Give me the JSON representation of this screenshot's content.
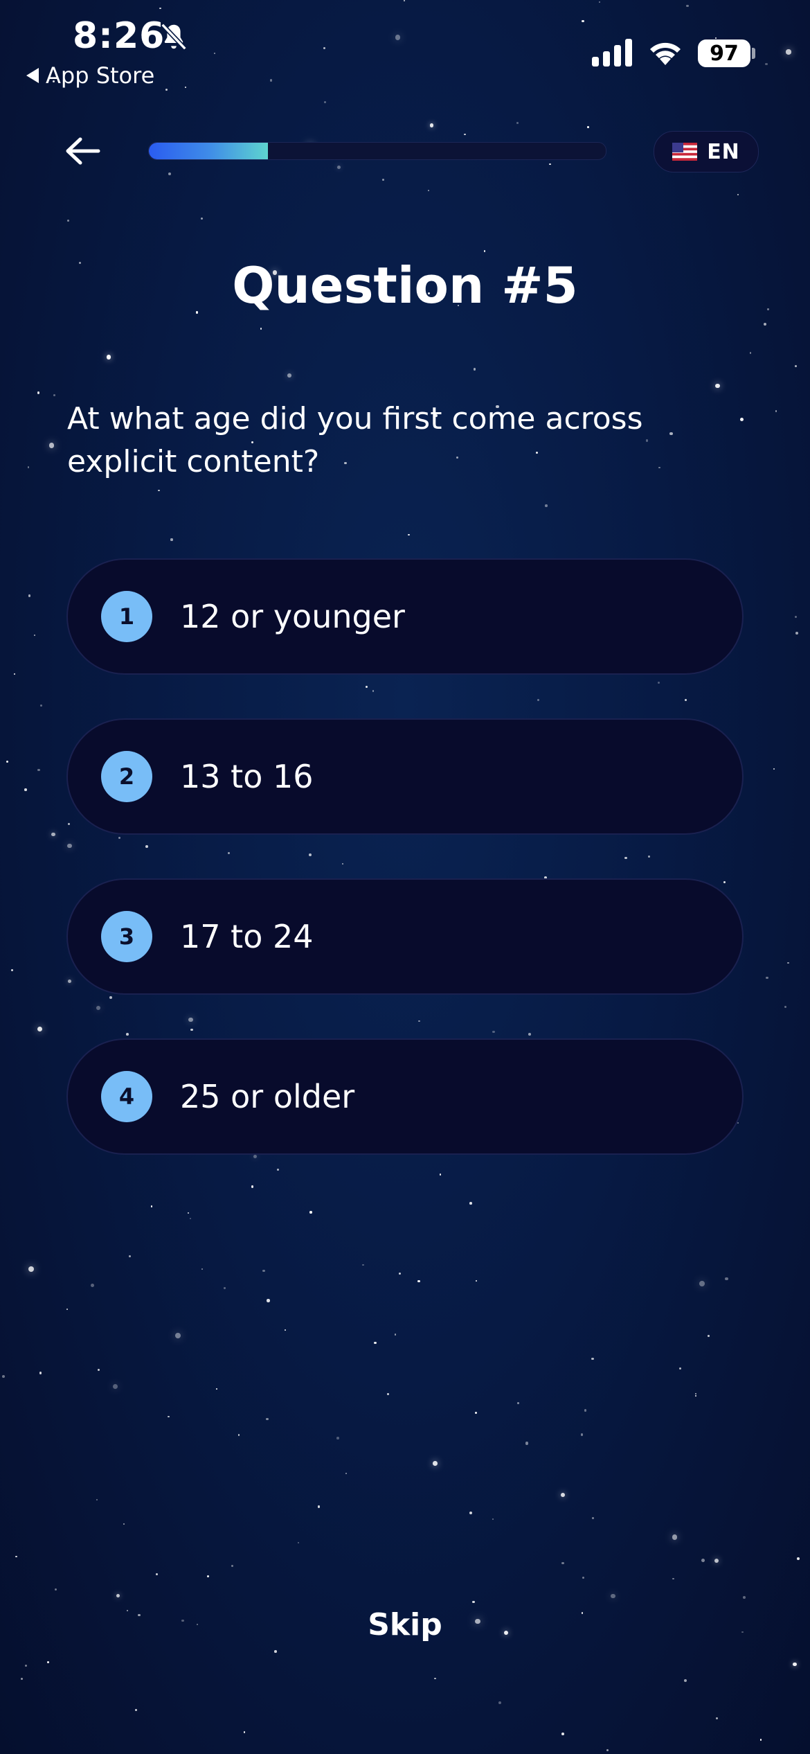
{
  "status_bar": {
    "time": "8:26",
    "back_app": "App Store",
    "battery": "97"
  },
  "nav": {
    "progress": 0.26,
    "language": "EN"
  },
  "title": "Question #5",
  "question": "At what age did you first come across explicit content?",
  "options": [
    {
      "number": "1",
      "label": "12 or younger"
    },
    {
      "number": "2",
      "label": "13 to 16"
    },
    {
      "number": "3",
      "label": "17 to 24"
    },
    {
      "number": "4",
      "label": "25 or older"
    }
  ],
  "skip_label": "Skip",
  "icons": {
    "mute": "bell-slash-icon",
    "signal": "cellular-signal-icon",
    "wifi": "wifi-icon",
    "back": "arrow-left-icon",
    "flag": "us-flag-icon"
  },
  "colors": {
    "background": "#071a44",
    "option_bg": "#080b2c",
    "number_badge": "#78bdf7",
    "progress_start": "#2a5cf0",
    "progress_end": "#5ed4cf"
  }
}
